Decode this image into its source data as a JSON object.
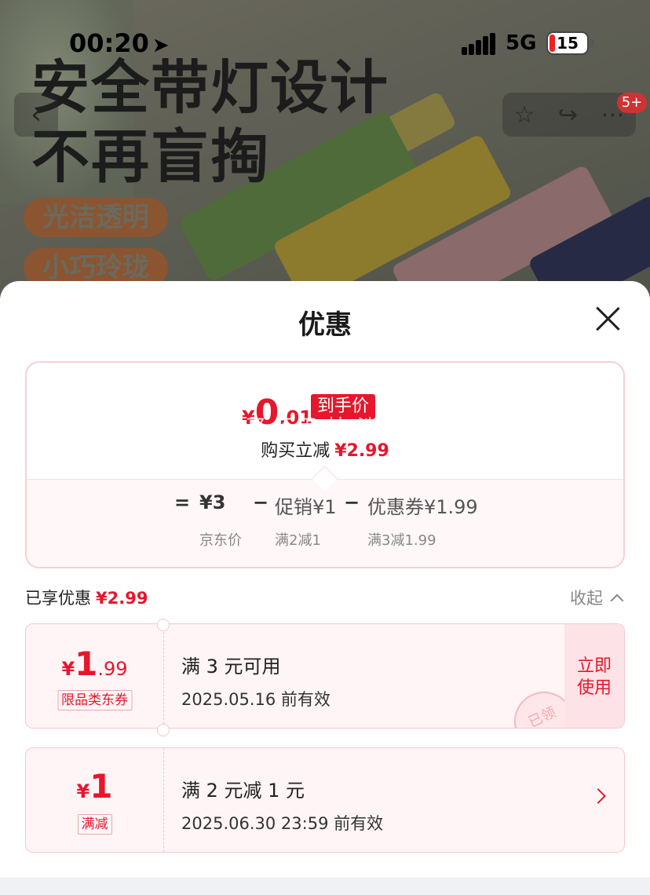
{
  "status_bar": {
    "time": "00:20",
    "location_icon": "➤",
    "network": "5G",
    "battery": "15"
  },
  "banner": {
    "headline_line1": "安全带灯设计",
    "headline_line2": "不再盲掏",
    "tag1": "光洁透明",
    "tag2": "小巧玲珑"
  },
  "nav": {
    "back_icon": "‹",
    "star_icon": "☆",
    "share_icon": "↪",
    "more_icon": "⋯",
    "badge": "5+"
  },
  "sheet": {
    "title": "优惠",
    "summary": {
      "price_symbol": "¥",
      "price_int": "0",
      "price_dec": ".01",
      "price_tag": "到手价",
      "watermark": "脚买 不用 技 淡 案",
      "saved_label": "购买立减",
      "saved_amount": "¥2.99",
      "formula": {
        "eq": "=",
        "base_price": "¥3",
        "minus1": "−",
        "promo": "促销¥1",
        "minus2": "−",
        "coupon": "优惠券¥1.99",
        "base_label": "京东价",
        "promo_label": "满2减1",
        "coupon_label": "满3减1.99"
      }
    },
    "enjoyed": {
      "label": "已享优惠",
      "amount": "¥2.99",
      "collapse": "收起"
    },
    "coupons": [
      {
        "symbol": "¥",
        "int": "1",
        "dec": ".99",
        "label": "限品类东券",
        "condition": "满 3 元可用",
        "expire": "2025.05.16 前有效",
        "action": "立即使用",
        "action_line1": "立即",
        "action_line2": "使用",
        "stamp": "已领"
      },
      {
        "symbol": "¥",
        "int": "1",
        "dec": "",
        "label": "满减",
        "condition": "满 2 元减 1 元",
        "expire": "2025.06.30 23:59 前有效"
      }
    ]
  },
  "colors": {
    "accent": "#e8162c",
    "coupon_bg": "#fff5f6",
    "border": "#f5c7cd"
  }
}
